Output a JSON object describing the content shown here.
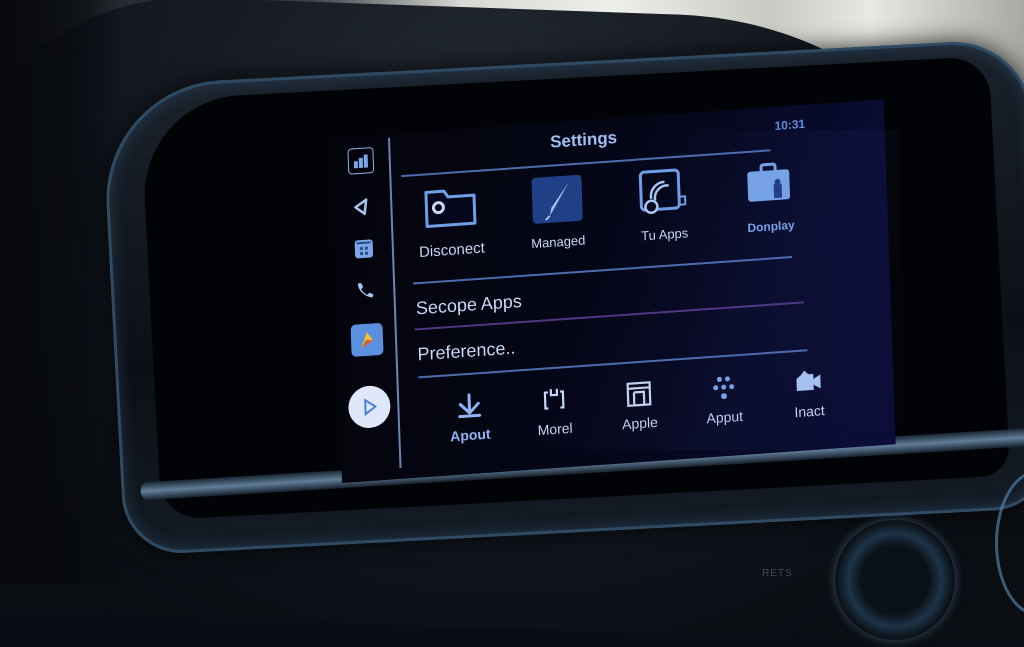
{
  "header": {
    "title": "Settings",
    "time": "10:31"
  },
  "sidebar": {
    "items": [
      {
        "name": "apps-grid",
        "label": "Apps"
      },
      {
        "name": "navigation",
        "label": "Navigation"
      },
      {
        "name": "calendar",
        "label": "Calendar"
      },
      {
        "name": "phone",
        "label": "Phone"
      },
      {
        "name": "maps",
        "label": "Maps"
      },
      {
        "name": "play",
        "label": "Play"
      }
    ]
  },
  "main": {
    "grid_items": [
      {
        "label": "Disconect",
        "icon": "folder-icon"
      },
      {
        "label": "Managed",
        "icon": "feather-pen-icon"
      },
      {
        "label": "Tu Apps",
        "icon": "wireless-icon"
      },
      {
        "label": "Donplay",
        "icon": "briefcase-icon"
      }
    ],
    "list_items": [
      {
        "label": "Secope Apps"
      },
      {
        "label": "Preference.."
      }
    ],
    "bottom_items": [
      {
        "label": "Apout",
        "icon": "download-arrow-icon"
      },
      {
        "label": "Morel",
        "icon": "bracket-device-icon"
      },
      {
        "label": "Apple",
        "icon": "window-grid-icon"
      },
      {
        "label": "Apput",
        "icon": "dots-cluster-icon"
      },
      {
        "label": "Inact",
        "icon": "camera-icon"
      }
    ]
  },
  "hardware": {
    "button_label": "RETS"
  },
  "colors": {
    "accent": "#5b8fe0",
    "text": "#c8d8f4",
    "divider": "#5b7fc8",
    "purple_divider": "#5a3b8e",
    "screen_bg": "#05071a"
  }
}
